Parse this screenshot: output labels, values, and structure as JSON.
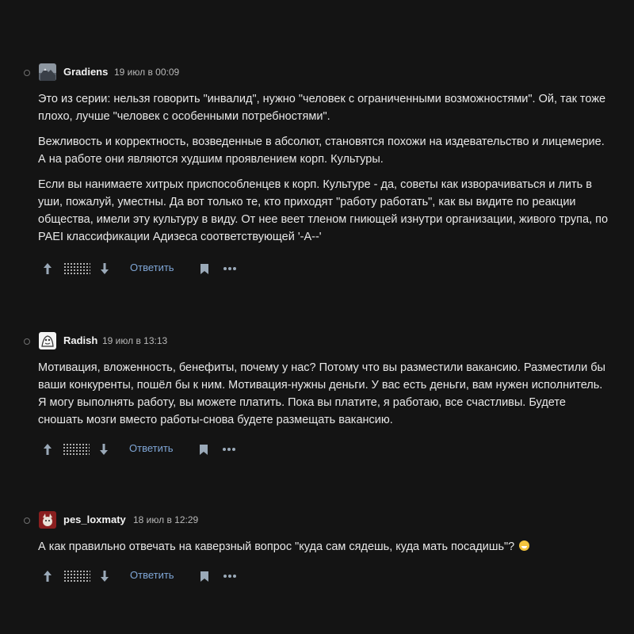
{
  "comments": [
    {
      "username": "Gradiens",
      "timestamp": "19 июл в 00:09",
      "avatar": "avatar-mountain",
      "paragraphs": [
        "Это из серии: нельзя говорить \"инвалид\", нужно \"человек с ограниченными возможностями\". Ой, так тоже плохо, лучше \"человек с особенными потребностями\".",
        "Вежливость и корректность, возведенные в абсолют, становятся похожи на издевательство и лицемерие. А на работе они являются худшим проявлением корп. Культуры.",
        "Если вы нанимаете хитрых приспособленцев к корп. Культуре - да, советы как изворачиваться и лить в уши, пожалуй, уместны. Да вот только те, кто приходят \"работу работать\", как вы видите по реакции общества, имели эту культуру в виду. От нее веет тленом гниющей изнутри организации, живого трупа, по PAEI классификации Адизеса соответствующей '-A--'"
      ],
      "reply_label": "Ответить"
    },
    {
      "username": "Radish",
      "timestamp": "19 июл в 13:13",
      "avatar": "avatar-sketch",
      "paragraphs": [
        "Мотивация, вложенность, бенефиты, почему у нас? Потому что вы разместили вакансию. Разместили бы ваши конкуренты, пошёл бы к ним. Мотивация-нужны деньги. У вас есть деньги, вам нужен исполнитель. Я могу выполнять работу, вы можете платить. Пока вы платите, я работаю, все счастливы. Будете сношать мозги вместо работы-снова будете размещать вакансию."
      ],
      "reply_label": "Ответить"
    },
    {
      "username": "pes_loxmaty",
      "timestamp": "18 июл в 12:29",
      "avatar": "avatar-red-dog",
      "paragraphs": [
        "А как правильно отвечать на каверзный вопрос \"куда сам сядешь, куда мать посадишь\"?"
      ],
      "emoji": "grinning-face-emoji",
      "reply_label": "Ответить"
    }
  ],
  "colors": {
    "background": "#141414",
    "text": "#e8e8e8",
    "reply_link": "#7fa6d6",
    "icon": "#9aa9b8"
  },
  "icons": {
    "upvote": "arrow-up-icon",
    "downvote": "arrow-down-icon",
    "bookmark": "bookmark-icon",
    "more": "more-dots-icon"
  }
}
